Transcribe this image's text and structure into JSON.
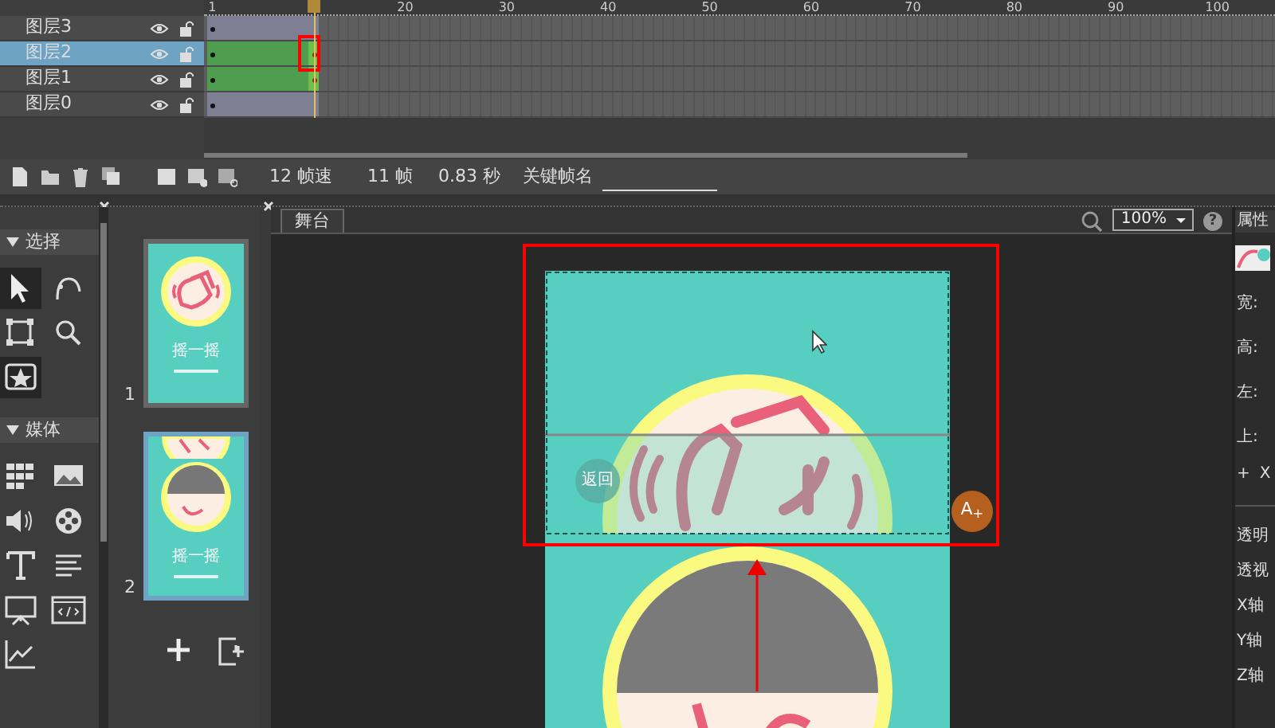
{
  "timeline": {
    "ruler": [
      "1",
      "20",
      "30",
      "40",
      "50",
      "60",
      "70",
      "80",
      "90",
      "100"
    ],
    "layers": [
      {
        "name": "图层3",
        "selected": false,
        "kind": "still"
      },
      {
        "name": "图层2",
        "selected": true,
        "kind": "motion"
      },
      {
        "name": "图层1",
        "selected": false,
        "kind": "motion"
      },
      {
        "name": "图层0",
        "selected": false,
        "kind": "still"
      }
    ]
  },
  "frame_bar": {
    "fps": "12 帧速",
    "frames": "11 帧",
    "seconds": "0.83 秒",
    "keyframe_name_label": "关键帧名"
  },
  "tool_panel": {
    "sections": [
      {
        "title": "选择",
        "expanded": true,
        "tools": [
          {
            "kind": "pointer",
            "selected": true
          },
          {
            "kind": "subselect",
            "selected": false
          },
          {
            "kind": "transform",
            "selected": false
          },
          {
            "kind": "zoom",
            "selected": false
          },
          {
            "kind": "component",
            "selected": true
          }
        ]
      },
      {
        "title": "媒体",
        "expanded": true,
        "tools": [
          {
            "kind": "grid",
            "selected": false
          },
          {
            "kind": "image",
            "selected": false
          },
          {
            "kind": "audio",
            "selected": false
          },
          {
            "kind": "video",
            "selected": false
          },
          {
            "kind": "text",
            "selected": false
          },
          {
            "kind": "paragraph",
            "selected": false
          },
          {
            "kind": "slideshow",
            "selected": false
          },
          {
            "kind": "html",
            "selected": false
          },
          {
            "kind": "chart",
            "selected": false
          }
        ]
      }
    ]
  },
  "pages": [
    {
      "number": "1",
      "title": "摇一摇",
      "selected": false,
      "kind": "shake"
    },
    {
      "number": "2",
      "title": "摇一摇",
      "selected": true,
      "kind": "photo"
    }
  ],
  "stage": {
    "tab": "舞台",
    "zoom": "100%",
    "help": "?",
    "back_label": "返回",
    "add_text_badge": "A$_{+}$"
  },
  "properties": {
    "tab": "属性",
    "fields": [
      "宽:",
      "高:",
      "左:",
      "上:"
    ],
    "offset_labels": [
      "+",
      "X"
    ],
    "options": [
      "透明",
      "透视",
      "X轴",
      "Y轴",
      "Z轴"
    ]
  }
}
